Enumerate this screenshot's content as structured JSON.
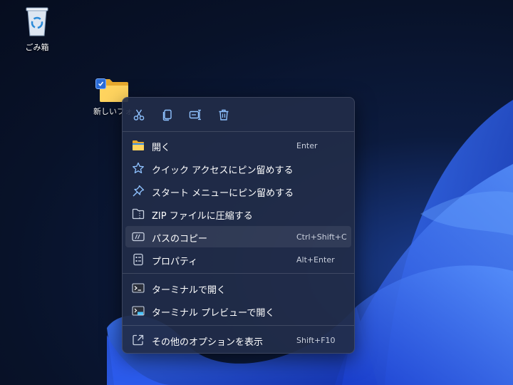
{
  "desktop": {
    "recycle_bin_label": "ごみ箱",
    "folder_label": "新しいフォル"
  },
  "context_menu": {
    "top_actions": [
      {
        "name": "cut-icon"
      },
      {
        "name": "copy-icon"
      },
      {
        "name": "rename-icon"
      },
      {
        "name": "delete-icon"
      }
    ],
    "items": [
      {
        "label": "開く",
        "shortcut": "Enter",
        "icon": "folder-open-icon"
      },
      {
        "label": "クイック アクセスにピン留めする",
        "shortcut": "",
        "icon": "star-icon"
      },
      {
        "label": "スタート メニューにピン留めする",
        "shortcut": "",
        "icon": "pin-icon"
      },
      {
        "label": "ZIP ファイルに圧縮する",
        "shortcut": "",
        "icon": "zip-folder-icon"
      },
      {
        "label": "パスのコピー",
        "shortcut": "Ctrl+Shift+C",
        "icon": "copy-path-icon"
      },
      {
        "label": "プロパティ",
        "shortcut": "Alt+Enter",
        "icon": "properties-icon"
      },
      {
        "label": "ターミナルで開く",
        "shortcut": "",
        "icon": "terminal-icon"
      },
      {
        "label": "ターミナル プレビューで開く",
        "shortcut": "",
        "icon": "terminal-preview-icon"
      },
      {
        "label": "その他のオプションを表示",
        "shortcut": "Shift+F10",
        "icon": "more-options-icon"
      }
    ]
  },
  "colors": {
    "accent": "#4aa3ff",
    "menu_background": "#212c48"
  }
}
